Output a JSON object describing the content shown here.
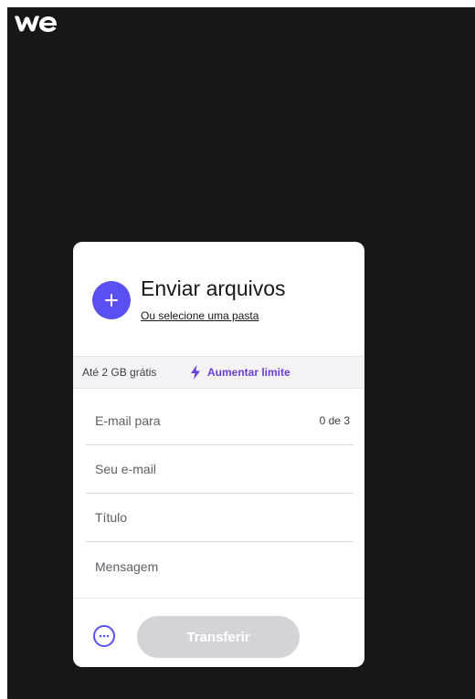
{
  "brand": {
    "logo_text": "we",
    "logo_color": "#ffffff"
  },
  "colors": {
    "page_background": "#171717",
    "accent": "#5a4ff0",
    "upgrade_accent": "#6a3fd8",
    "disabled_button": "#d4d4d8"
  },
  "upload": {
    "add_icon": "plus-icon",
    "title": "Enviar arquivos",
    "folder_link": "Ou selecione uma pasta"
  },
  "limit": {
    "text": "Até 2 GB grátis",
    "icon": "lightning-bolt-icon",
    "upgrade_link": "Aumentar limite"
  },
  "form": {
    "email_to": {
      "placeholder": "E-mail para",
      "counter": "0 de 3"
    },
    "your_email": {
      "placeholder": "Seu e-mail"
    },
    "title": {
      "placeholder": "Título"
    },
    "message": {
      "placeholder": "Mensagem"
    }
  },
  "footer": {
    "more_icon": "more-options-icon",
    "transfer_label": "Transferir",
    "transfer_enabled": false
  }
}
